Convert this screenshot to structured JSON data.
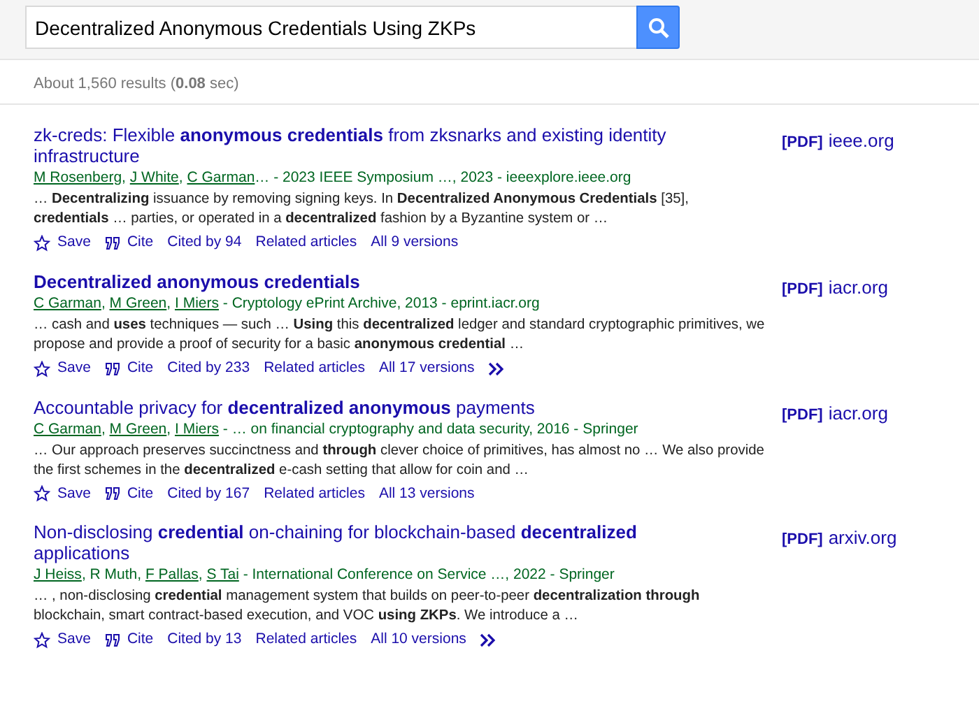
{
  "search": {
    "value": "Decentralized Anonymous Credentials Using ZKPs"
  },
  "results_summary": "About 1,560 results (**0.08** sec)",
  "results": [
    {
      "title": "zk-creds: Flexible **anonymous credentials** from zksnarks and existing identity infrastructure",
      "authors": [
        {
          "name": "M Rosenberg",
          "linked": true,
          "sep": ","
        },
        {
          "name": "J White",
          "linked": true,
          "sep": ","
        },
        {
          "name": "C Garman",
          "linked": true
        }
      ],
      "source": "… - 2023 IEEE Symposium …, 2023 - ieeexplore.ieee.org",
      "snippet": "… **Decentralizing** issuance by removing signing keys. In **Decentralized Anonymous Credentials** [35], **credentials** … parties, or operated in a **decentralized** fashion by a Byzantine system or …",
      "actions": [
        "Save",
        "Cite",
        "Cited by 94",
        "Related articles",
        "All 9 versions"
      ],
      "more": false,
      "pdf_label": "[PDF]",
      "pdf_site": "ieee.org"
    },
    {
      "title": "**Decentralized anonymous credentials**",
      "authors": [
        {
          "name": "C Garman",
          "linked": true,
          "sep": ","
        },
        {
          "name": "M Green",
          "linked": true,
          "sep": ","
        },
        {
          "name": "I Miers",
          "linked": true
        }
      ],
      "source": " - Cryptology ePrint Archive, 2013 - eprint.iacr.org",
      "snippet": "… cash and **uses** techniques — such … **Using** this **decentralized** ledger and standard cryptographic primitives, we propose and provide a proof of security for a basic **anonymous credential** …",
      "actions": [
        "Save",
        "Cite",
        "Cited by 233",
        "Related articles",
        "All 17 versions"
      ],
      "more": true,
      "pdf_label": "[PDF]",
      "pdf_site": "iacr.org"
    },
    {
      "title": "Accountable privacy for **decentralized anonymous** payments",
      "authors": [
        {
          "name": "C Garman",
          "linked": true,
          "sep": ","
        },
        {
          "name": "M Green",
          "linked": true,
          "sep": ","
        },
        {
          "name": "I Miers",
          "linked": true
        }
      ],
      "source": " - … on financial cryptography and data security, 2016 - Springer",
      "snippet": "… Our approach preserves succinctness and **through** clever choice of primitives, has almost no … We also provide the first schemes in the **decentralized** e-cash setting that allow for coin and …",
      "actions": [
        "Save",
        "Cite",
        "Cited by 167",
        "Related articles",
        "All 13 versions"
      ],
      "more": false,
      "pdf_label": "[PDF]",
      "pdf_site": "iacr.org"
    },
    {
      "title": "Non-disclosing **credential** on-chaining for blockchain-based **decentralized** applications",
      "authors": [
        {
          "name": "J Heiss",
          "linked": true,
          "sep": ","
        },
        {
          "name": "R Muth",
          "linked": false,
          "sep": ","
        },
        {
          "name": "F Pallas",
          "linked": true,
          "sep": ","
        },
        {
          "name": "S Tai",
          "linked": true
        }
      ],
      "source": " - International Conference on Service …, 2022 - Springer",
      "snippet": "… , non-disclosing **credential** management system that builds on peer-to-peer **decentralization** **through** blockchain, smart contract-based execution, and VOC **using ZKPs**. We introduce a …",
      "actions": [
        "Save",
        "Cite",
        "Cited by 13",
        "Related articles",
        "All 10 versions"
      ],
      "more": true,
      "pdf_label": "[PDF]",
      "pdf_site": "arxiv.org"
    }
  ]
}
